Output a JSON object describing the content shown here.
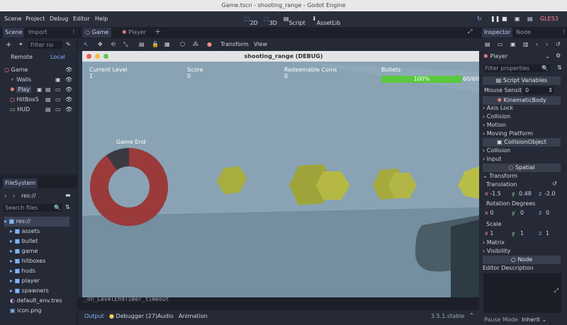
{
  "window_title": "Game.tscn - shooting_range - Godot Engine",
  "menus": [
    "Scene",
    "Project",
    "Debug",
    "Editor",
    "Help"
  ],
  "workspaces": [
    "2D",
    "3D",
    "Script",
    "AssetLib"
  ],
  "renderer": "GLES3",
  "scene_panel": {
    "tabs": [
      "Scene",
      "Import"
    ],
    "filter_placeholder": "Filter no",
    "remote": "Remote",
    "local": "Local",
    "nodes": [
      "Game",
      "Walls",
      "Play",
      "HitBoxS",
      "HUD"
    ]
  },
  "filesystem": {
    "title": "FileSystem",
    "path": "res://",
    "search_placeholder": "Search files",
    "root": "res://",
    "items": [
      "assets",
      "bullet",
      "game",
      "hitboxes",
      "huds",
      "player",
      "spawners",
      "default_env.tres",
      "icon.png"
    ]
  },
  "editor_tabs": [
    "Game",
    "Player"
  ],
  "viewport_menu": [
    "Transform",
    "View"
  ],
  "game_window": {
    "title": "shooting_range (DEBUG)",
    "hud": {
      "level_label": "Current Level",
      "level_value": "1",
      "score_label": "Score",
      "score_value": "0",
      "coins_label": "Redeemable Coins",
      "coins_value": "0",
      "bullets_label": "Bullets",
      "bullets_percent": "100%",
      "bullets_count": "60/60",
      "bullets_fraction": 1.0
    },
    "game_end_label": "Game End",
    "game_end_progress": 0.9
  },
  "output_line": "_on_LevelEndTimer_timeout",
  "bottom_tabs": {
    "output": "Output",
    "debugger": "Debugger (27)",
    "audio": "Audio",
    "animation": "Animation",
    "version": "3.5.1.stable"
  },
  "inspector": {
    "tabs": [
      "Inspector",
      "Node"
    ],
    "node_name": "Player",
    "filter_placeholder": "Filter properties",
    "mouse_sens_label": "Mouse Sensit",
    "mouse_sens_value": "0",
    "script_variables": "Script Variables",
    "kinematic_body": "KinematicBody",
    "kb_props": [
      "Axis Lock",
      "Collision",
      "Motion",
      "Moving Platform"
    ],
    "collision_object": "CollisionObject",
    "co_props": [
      "Collision",
      "Input"
    ],
    "spatial": "Spatial",
    "transform": "Transform",
    "translation_label": "Translation",
    "translation": {
      "x": "-1.5",
      "y": "0.48",
      "z": "-2.0"
    },
    "rotation_label": "Rotation Degrees",
    "rotation": {
      "x": "0",
      "y": "0",
      "z": "0"
    },
    "scale_label": "Scale",
    "scale": {
      "x": "1",
      "y": "1",
      "z": "1"
    },
    "matrix": "Matrix",
    "visibility": "Visibility",
    "node_section": "Node",
    "editor_description": "Editor Description",
    "pause_mode_label": "Pause Mode",
    "pause_mode_value": "Inherit"
  }
}
